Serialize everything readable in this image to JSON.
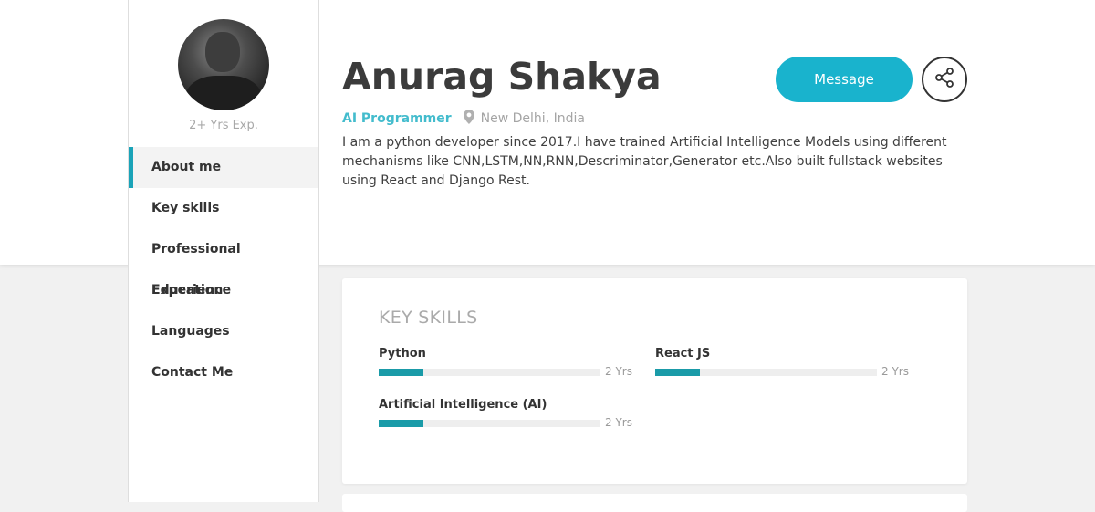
{
  "profile": {
    "name": "Anurag Shakya",
    "experience": "2+ Yrs Exp.",
    "role": "AI Programmer",
    "location": "New Delhi, India",
    "bio": "I am a python developer since 2017.I have trained Artificial Intelligence Models using different mechanisms like CNN,LSTM,NN,RNN,Descriminator,Generator etc.Also built fullstack websites using React and Django Rest."
  },
  "actions": {
    "message_label": "Message",
    "share_icon": "share-icon"
  },
  "sidebar": {
    "items": [
      {
        "label": "About me",
        "active": true
      },
      {
        "label": "Key skills",
        "active": false
      },
      {
        "label": "Professional Experience",
        "active": false
      },
      {
        "label": "Education",
        "active": false
      },
      {
        "label": "Languages",
        "active": false
      },
      {
        "label": "Contact Me",
        "active": false
      }
    ]
  },
  "skills_card": {
    "title": "KEY SKILLS",
    "skills": [
      {
        "name": "Python",
        "years": "2 Yrs",
        "level": 0.2
      },
      {
        "name": "React JS",
        "years": "2 Yrs",
        "level": 0.2
      },
      {
        "name": "Artificial Intelligence (AI)",
        "years": "2 Yrs",
        "level": 0.2
      }
    ]
  },
  "colors": {
    "accent": "#19b3cd",
    "bar": "#1a9ba8",
    "role": "#43bccd"
  }
}
